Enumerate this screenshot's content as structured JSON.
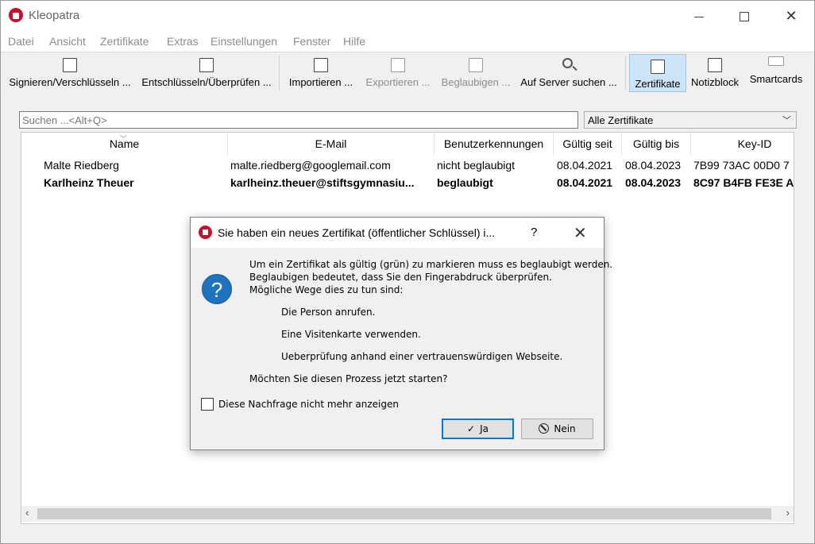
{
  "window": {
    "title": "Kleopatra"
  },
  "menu": [
    "Datei",
    "Ansicht",
    "Zertifikate",
    "Extras",
    "Einstellungen",
    "Fenster",
    "Hilfe"
  ],
  "toolbar": {
    "sign": "Signieren/Verschlüsseln ...",
    "decrypt": "Entschlüsseln/Überprüfen ...",
    "import": "Importieren ...",
    "export": "Exportieren ...",
    "certify": "Beglaubigen ...",
    "server": "Auf Server suchen ...",
    "certs": "Zertifikate",
    "notepad": "Notizblock",
    "smartcards": "Smartcards"
  },
  "search": {
    "placeholder": "Suchen ...<Alt+Q>"
  },
  "filter": {
    "selected": "Alle Zertifikate"
  },
  "table": {
    "columns": [
      "Name",
      "E-Mail",
      "Benutzerkennungen",
      "Gültig seit",
      "Gültig bis",
      "Key-ID"
    ],
    "rows": [
      {
        "name": "Malte Riedberg",
        "email": "malte.riedberg@googlemail.com",
        "uid": "nicht beglaubigt",
        "from": "08.04.2021",
        "to": "08.04.2023",
        "keyid": "7B99 73AC 00D0 7"
      },
      {
        "name": "Karlheinz Theuer",
        "email": "karlheinz.theuer@stiftsgymnasiu...",
        "uid": "beglaubigt",
        "from": "08.04.2021",
        "to": "08.04.2023",
        "keyid": "8C97 B4FB FE3E A"
      }
    ]
  },
  "dialog": {
    "title": "Sie haben ein neues Zertifikat (öffentlicher Schlüssel) i...",
    "help": "?",
    "lines": [
      "Um ein Zertifikat als gültig (grün) zu markieren muss es beglaubigt werden.",
      "Beglaubigen bedeutet, dass Sie den Fingerabdruck überprüfen.",
      "Mögliche Wege dies zu tun sind:",
      "Die Person anrufen.",
      "Eine Visitenkarte verwenden.",
      "Ueberprüfung anhand einer vertrauenswürdigen Webseite.",
      "Möchten Sie diesen Prozess jetzt starten?"
    ],
    "checkbox_label": "Diese Nachfrage nicht mehr anzeigen",
    "yes": "Ja",
    "no": "Nein"
  }
}
